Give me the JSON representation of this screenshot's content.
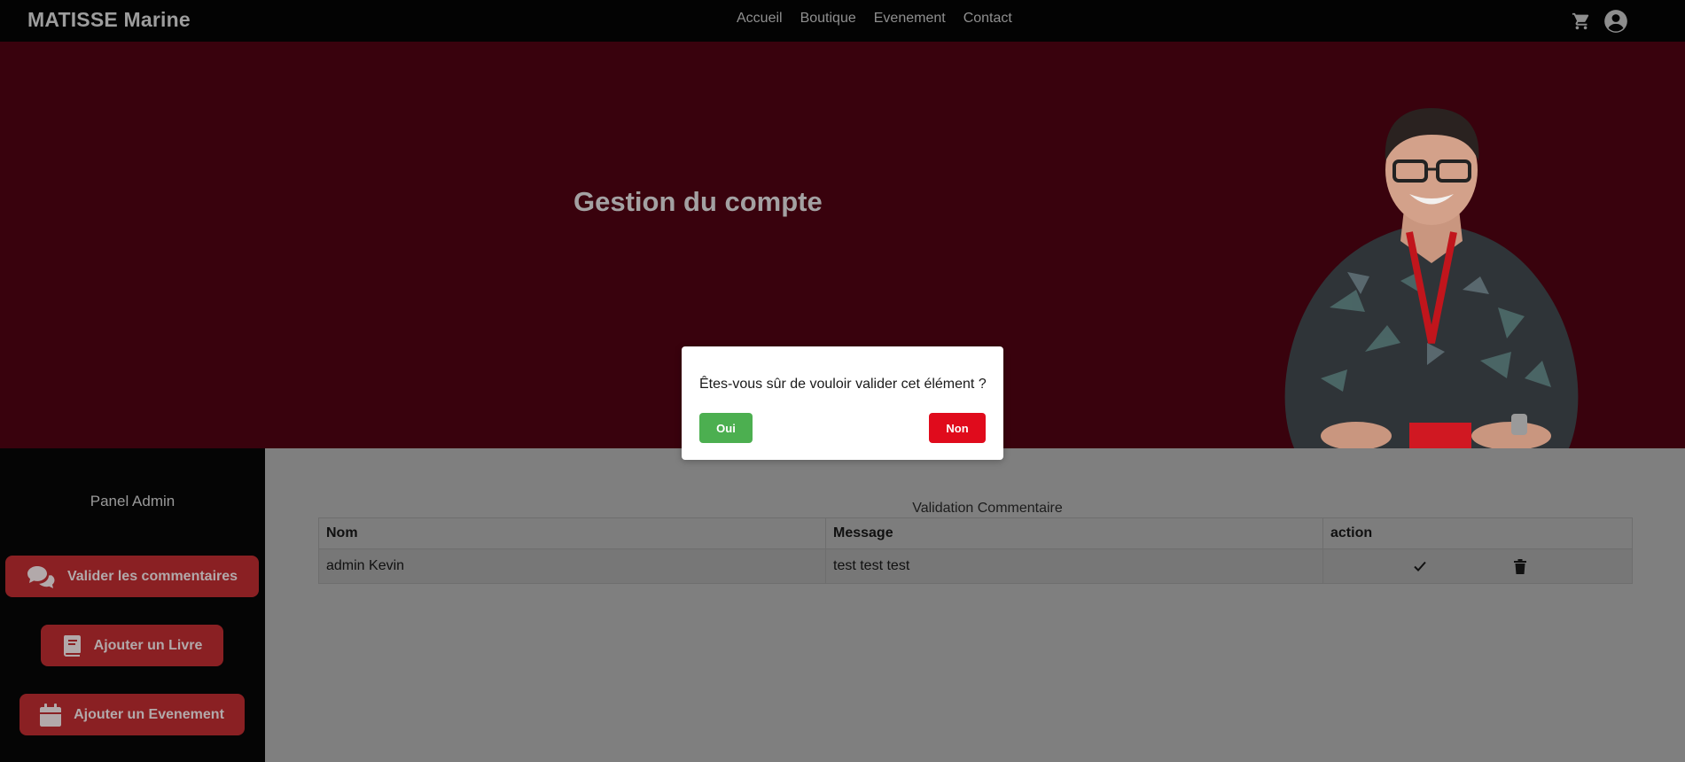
{
  "brand": "MATISSE Marine",
  "nav": {
    "links": [
      "Accueil",
      "Boutique",
      "Evenement",
      "Contact"
    ],
    "icons": [
      "cart-icon",
      "user-circle-icon"
    ]
  },
  "hero": {
    "title": "Gestion du compte"
  },
  "sidebar": {
    "title": "Panel Admin",
    "buttons": [
      {
        "label": "Valider les commentaires",
        "icon": "comments-icon"
      },
      {
        "label": "Ajouter un Livre",
        "icon": "book-icon"
      },
      {
        "label": "Ajouter un Evenement",
        "icon": "calendar-icon"
      }
    ]
  },
  "table": {
    "caption": "Validation Commentaire",
    "headers": [
      "Nom",
      "Message",
      "action"
    ],
    "rows": [
      {
        "nom": "admin Kevin",
        "message": "test test test",
        "actions": [
          "check-icon",
          "trash-icon"
        ]
      }
    ]
  },
  "modal": {
    "message": "Êtes-vous sûr de vouloir valider cet élément ?",
    "confirm_label": "Oui",
    "cancel_label": "Non"
  },
  "colors": {
    "hero_bg": "#39020d",
    "accent_red": "#8a2023",
    "confirm_green": "#4caf50",
    "cancel_red": "#e00b1c"
  }
}
